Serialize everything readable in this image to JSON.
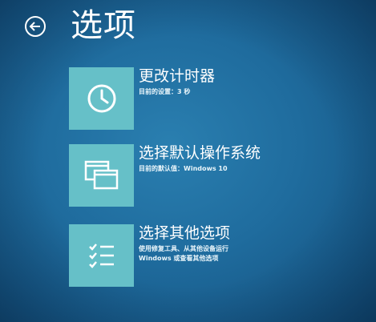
{
  "header": {
    "title": "选项",
    "back_icon": "back-arrow-icon"
  },
  "options": [
    {
      "title": "更改计时器",
      "desc_lines": [
        "目前的设置：3 秒"
      ],
      "icon": "clock-icon"
    },
    {
      "title": "选择默认操作系统",
      "desc_lines": [
        "目前的默认值：Windows 10"
      ],
      "icon": "windows-icon"
    },
    {
      "title": "选择其他选项",
      "desc_lines": [
        "使用修复工具、从其他设备运行",
        "Windows 或查看其他选项"
      ],
      "icon": "checklist-icon"
    }
  ],
  "colors": {
    "background": "#1f6c9e",
    "tile": "#66c0c8",
    "text": "#ffffff"
  }
}
